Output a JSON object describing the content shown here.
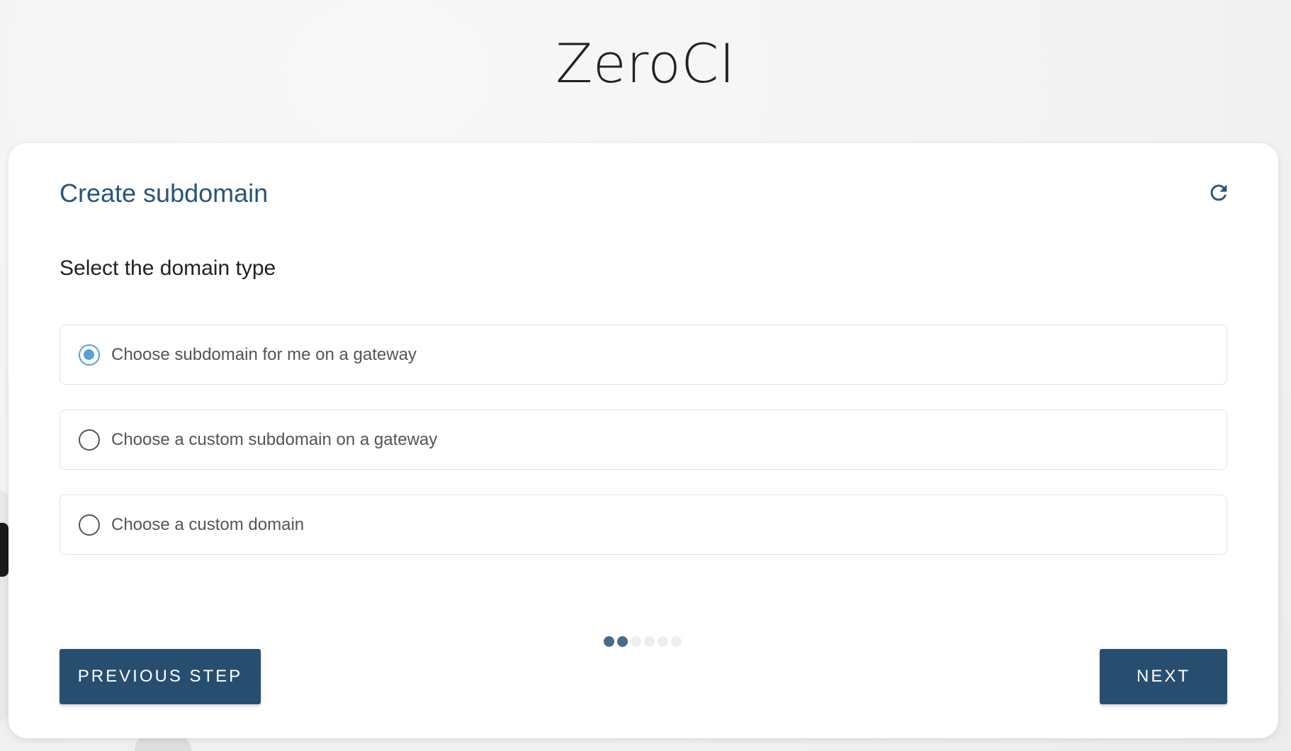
{
  "app": {
    "title": "ZeroCI"
  },
  "wizard": {
    "title": "Create subdomain",
    "question": "Select the domain type",
    "options": [
      {
        "label": "Choose subdomain for me on a gateway",
        "selected": true
      },
      {
        "label": "Choose a custom subdomain on a gateway",
        "selected": false
      },
      {
        "label": "Choose a custom domain",
        "selected": false
      }
    ],
    "steps": {
      "completed": 2,
      "total": 6
    },
    "icons": {
      "refresh": "refresh-icon"
    },
    "colors": {
      "accent": "#284e6f",
      "title": "#2a5578",
      "radio": "#5a9fd6"
    }
  },
  "buttons": {
    "previous": "PREVIOUS STEP",
    "next": "NEXT"
  }
}
